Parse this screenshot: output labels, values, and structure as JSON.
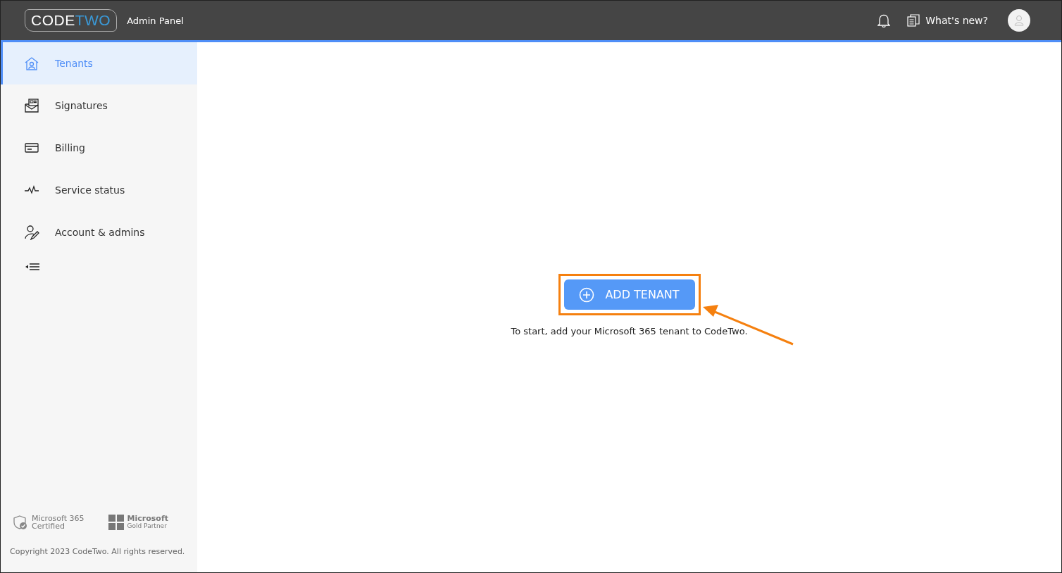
{
  "header": {
    "logo": {
      "first": "CODE",
      "second": "TWO"
    },
    "title": "Admin Panel",
    "whats_new": "What's new?"
  },
  "sidebar": {
    "items": [
      {
        "label": "Tenants",
        "selected": true
      },
      {
        "label": "Signatures",
        "selected": false
      },
      {
        "label": "Billing",
        "selected": false
      },
      {
        "label": "Service status",
        "selected": false
      },
      {
        "label": "Account & admins",
        "selected": false
      }
    ],
    "badges": [
      {
        "kind": "certified",
        "line_1": "Microsoft 365",
        "line_2": "Certified"
      },
      {
        "kind": "partner",
        "line_1": "Microsoft",
        "line_2": "Gold Partner"
      }
    ],
    "copyright": "Copyright 2023 CodeTwo. All rights reserved."
  },
  "main": {
    "button": "ADD TENANT",
    "hint": "To start, add your Microsoft 365 tenant to CodeTwo."
  }
}
